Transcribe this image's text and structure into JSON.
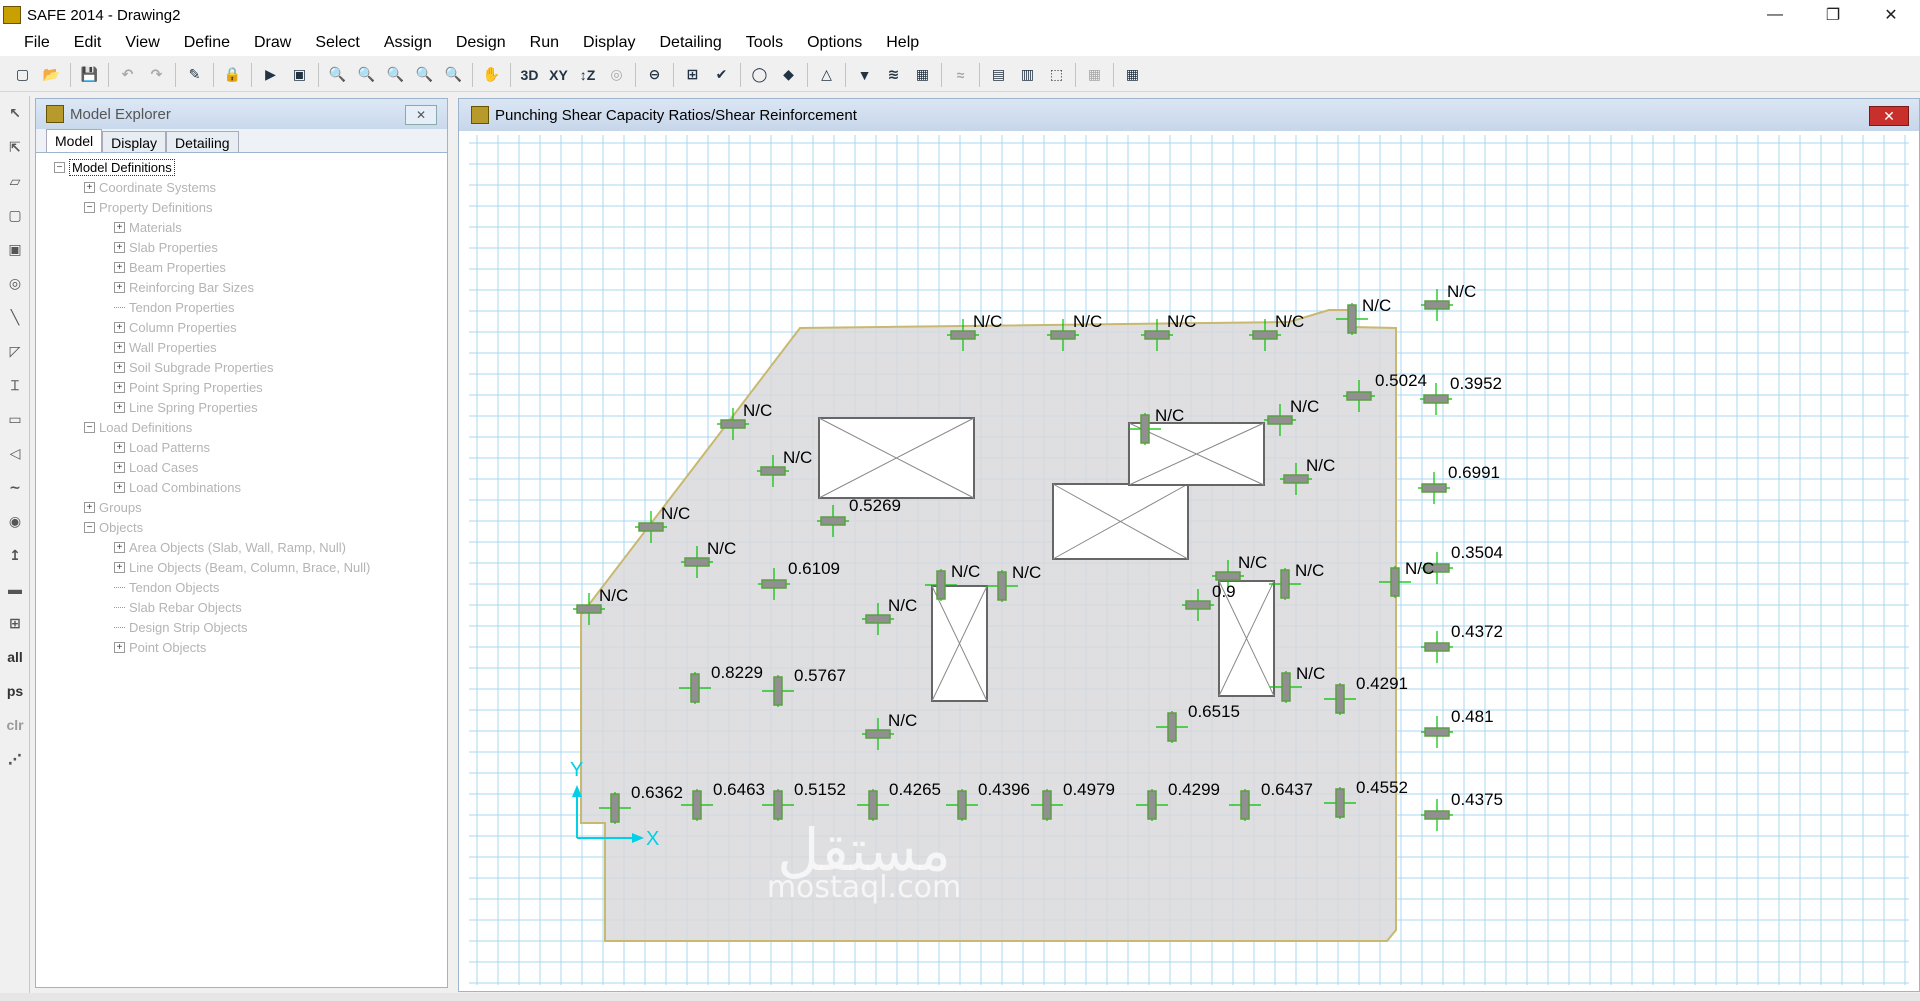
{
  "window": {
    "title": "SAFE 2014 - Drawing2",
    "buttons": [
      "—",
      "❐",
      "✕"
    ]
  },
  "menubar": [
    "File",
    "Edit",
    "View",
    "Define",
    "Draw",
    "Select",
    "Assign",
    "Design",
    "Run",
    "Display",
    "Detailing",
    "Tools",
    "Options",
    "Help"
  ],
  "toolbar": {
    "view_3d": "3D",
    "view_xy": "XY",
    "view_xz": "↕Z"
  },
  "lefttools": {
    "all": "all",
    "ps": "ps",
    "clr": "clr"
  },
  "explorer": {
    "title": "Model Explorer",
    "close": "✕",
    "tabs": [
      "Model",
      "Display",
      "Detailing"
    ],
    "tree": [
      {
        "label": "Model Definitions",
        "level": 0,
        "expander": "−",
        "root": true
      },
      {
        "label": "Coordinate Systems",
        "level": 1,
        "expander": "+"
      },
      {
        "label": "Property Definitions",
        "level": 1,
        "expander": "−"
      },
      {
        "label": "Materials",
        "level": 2,
        "expander": "+"
      },
      {
        "label": "Slab Properties",
        "level": 2,
        "expander": "+"
      },
      {
        "label": "Beam Properties",
        "level": 2,
        "expander": "+"
      },
      {
        "label": "Reinforcing Bar Sizes",
        "level": 2,
        "expander": "+"
      },
      {
        "label": "Tendon Properties",
        "level": 2,
        "expander": ""
      },
      {
        "label": "Column Properties",
        "level": 2,
        "expander": "+"
      },
      {
        "label": "Wall Properties",
        "level": 2,
        "expander": "+"
      },
      {
        "label": "Soil Subgrade Properties",
        "level": 2,
        "expander": "+"
      },
      {
        "label": "Point Spring Properties",
        "level": 2,
        "expander": "+"
      },
      {
        "label": "Line Spring Properties",
        "level": 2,
        "expander": "+"
      },
      {
        "label": "Load Definitions",
        "level": 1,
        "expander": "−"
      },
      {
        "label": "Load Patterns",
        "level": 2,
        "expander": "+"
      },
      {
        "label": "Load Cases",
        "level": 2,
        "expander": "+"
      },
      {
        "label": "Load Combinations",
        "level": 2,
        "expander": "+"
      },
      {
        "label": "Groups",
        "level": 1,
        "expander": "+"
      },
      {
        "label": "Objects",
        "level": 1,
        "expander": "−"
      },
      {
        "label": "Area Objects (Slab, Wall, Ramp, Null)",
        "level": 2,
        "expander": "+"
      },
      {
        "label": "Line Objects (Beam, Column, Brace, Null)",
        "level": 2,
        "expander": "+"
      },
      {
        "label": "Tendon Objects",
        "level": 2,
        "expander": ""
      },
      {
        "label": "Slab Rebar Objects",
        "level": 2,
        "expander": ""
      },
      {
        "label": "Design Strip Objects",
        "level": 2,
        "expander": ""
      },
      {
        "label": "Point Objects",
        "level": 2,
        "expander": "+"
      }
    ]
  },
  "viewer": {
    "title": "Punching Shear Capacity Ratios/Shear Reinforcement",
    "close": "✕",
    "axis_x": "X",
    "axis_y": "Y",
    "watermark_text": "mostaql.com",
    "watermark_arabic": "مستقل",
    "colors": {
      "grid": "#a8d8f0",
      "slab": "#d9d9dc",
      "slab_edge": "#c8b870",
      "column": "#5aa040",
      "strip": "#00c000",
      "ratio_text": "#000000",
      "axis": "#00d0e8"
    },
    "ratios": [
      "N/C",
      "N/C",
      "N/C",
      "N/C",
      "N/C",
      "N/C",
      "0.5024",
      "0.3952",
      "N/C",
      "N/C",
      "N/C",
      "N/C",
      "N/C",
      "0.6991",
      "0.5269",
      "N/C",
      "N/C",
      "N/C",
      "0.3504",
      "0.6109",
      "N/C",
      "N/C",
      "N/C",
      "N/C",
      "N/C",
      "0.9",
      "N/C",
      "0.4372",
      "0.8229",
      "0.5767",
      "N/C",
      "0.4291",
      "0.6515",
      "N/C",
      "0.481",
      "0.6362",
      "0.6463",
      "0.5152",
      "0.4265",
      "0.4396",
      "0.4979",
      "0.4299",
      "0.6437",
      "0.4552",
      "0.4375"
    ]
  }
}
